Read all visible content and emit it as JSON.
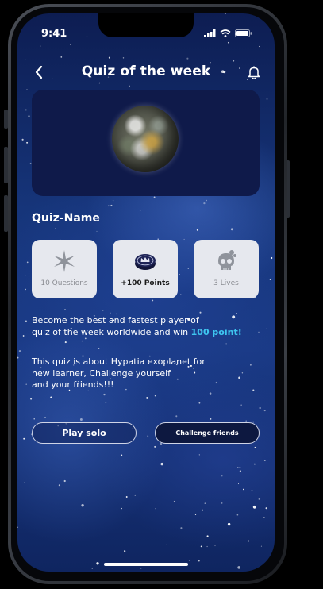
{
  "status": {
    "time": "9:41",
    "icons": [
      "signal-icon",
      "wifi-icon",
      "battery-icon"
    ]
  },
  "header": {
    "title": "Quiz of the week",
    "back_icon": "chevron-left-icon",
    "notification_icon": "bell-icon"
  },
  "hero": {
    "image": "planet-image"
  },
  "quiz": {
    "name": "Quiz-Name",
    "cards": [
      {
        "icon": "star-burst-icon",
        "label": "10 Questions"
      },
      {
        "icon": "coin-crown-icon",
        "label": "+100 Points"
      },
      {
        "icon": "skull-icon",
        "label": "3 Lives"
      }
    ],
    "description_line1": "Become the best and fastest player of",
    "description_line2": "quiz of the week worldwide and win ",
    "description_highlight": "100 point!",
    "about_line1": "This quiz is about Hypatia exoplanet for",
    "about_line2": "new learner, Challenge yourself",
    "about_line3": "and your friends!!!"
  },
  "actions": {
    "play_solo": "Play solo",
    "challenge_friends": "Challenge friends"
  },
  "colors": {
    "highlight": "#3ec6f0",
    "card_bg": "#e6e8ee",
    "hero_bg": "#0f1a4a"
  }
}
